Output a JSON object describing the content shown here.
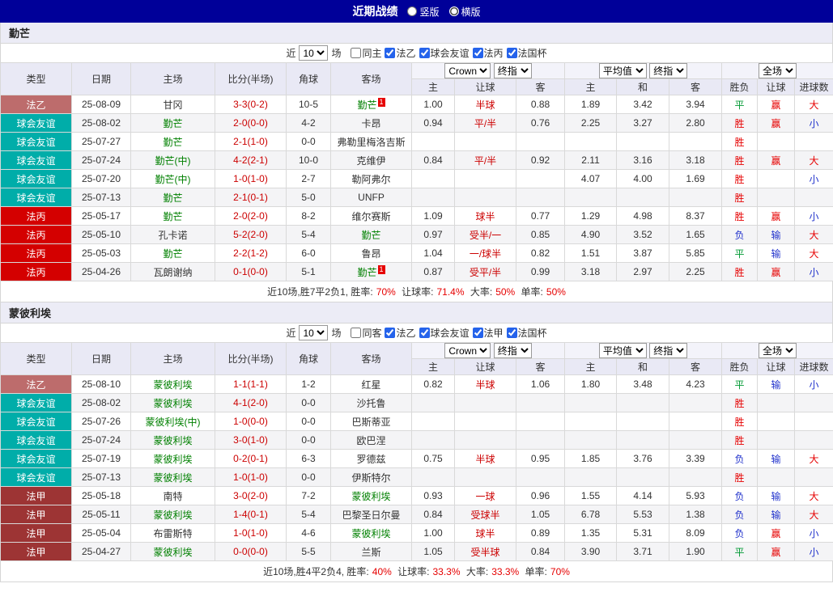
{
  "header": {
    "title": "近期战绩",
    "layout_options": [
      "竖版",
      "横版"
    ],
    "layout_checked": [
      false,
      true
    ],
    "selected_layout": "横版"
  },
  "filters": {
    "near_label": "近",
    "count": "10",
    "matches_label": "场"
  },
  "selects": {
    "company": "Crown",
    "final_odds": "终指",
    "average": "平均值",
    "full_match": "全场"
  },
  "columns": {
    "type": "类型",
    "date": "日期",
    "home": "主场",
    "score": "比分(半场)",
    "corner": "角球",
    "away": "客场",
    "odds_home": "主",
    "odds_handicap": "让球",
    "odds_away": "客",
    "avg_home": "主",
    "avg_draw": "和",
    "avg_away": "客",
    "result": "胜负",
    "handicap_result": "让球",
    "goals_result": "进球数"
  },
  "colors": {
    "title_bar": "#000099",
    "header_bg": "#e9e9f5",
    "score": "#cc0000",
    "handicap": "#cc0000",
    "self_team": "#008000",
    "opponent_team": "#333333",
    "badge": "#e60000",
    "highlight": "#e60000",
    "result_win": "#e60000",
    "result_draw": "#009933",
    "result_lose": "#2233cc"
  },
  "league_colors": {
    "法乙": "#bd6c6c",
    "球会友谊": "#00ada9",
    "法丙": "#d40000",
    "法甲": "#9d3434"
  },
  "sections": [
    {
      "team": "勤芒",
      "filter": {
        "same_label": "同主",
        "same_checked": false,
        "leagues": [
          "法乙",
          "球会友谊",
          "法丙",
          "法国杯"
        ],
        "leagues_checked": [
          true,
          true,
          true,
          true
        ]
      },
      "rows": [
        {
          "type": "法乙",
          "date": "25-08-09",
          "home": "甘冈",
          "home_self": false,
          "score": "3-3(0-2)",
          "corner": "10-5",
          "away": "勤芒",
          "away_self": true,
          "away_badge": "1",
          "odds": [
            "1.00",
            "半球",
            "0.88"
          ],
          "avg": [
            "1.89",
            "3.42",
            "3.94"
          ],
          "results": [
            "平",
            "赢",
            "大"
          ]
        },
        {
          "type": "球会友谊",
          "date": "25-08-02",
          "home": "勤芒",
          "home_self": true,
          "score": "2-0(0-0)",
          "corner": "4-2",
          "away": "卡昂",
          "away_self": false,
          "odds": [
            "0.94",
            "平/半",
            "0.76"
          ],
          "avg": [
            "2.25",
            "3.27",
            "2.80"
          ],
          "results": [
            "胜",
            "赢",
            "小"
          ]
        },
        {
          "type": "球会友谊",
          "date": "25-07-27",
          "home": "勤芒",
          "home_self": true,
          "score": "2-1(1-0)",
          "corner": "0-0",
          "away": "弗勒里梅洛吉斯",
          "away_self": false,
          "odds": [
            "",
            "",
            ""
          ],
          "avg": [
            "",
            "",
            ""
          ],
          "results": [
            "胜",
            "",
            ""
          ]
        },
        {
          "type": "球会友谊",
          "date": "25-07-24",
          "home": "勤芒(中)",
          "home_self": true,
          "score": "4-2(2-1)",
          "corner": "10-0",
          "away": "克维伊",
          "away_self": false,
          "odds": [
            "0.84",
            "平/半",
            "0.92"
          ],
          "avg": [
            "2.11",
            "3.16",
            "3.18"
          ],
          "results": [
            "胜",
            "赢",
            "大"
          ]
        },
        {
          "type": "球会友谊",
          "date": "25-07-20",
          "home": "勤芒(中)",
          "home_self": true,
          "score": "1-0(1-0)",
          "corner": "2-7",
          "away": "勒阿弗尔",
          "away_self": false,
          "odds": [
            "",
            "",
            ""
          ],
          "avg": [
            "4.07",
            "4.00",
            "1.69"
          ],
          "results": [
            "胜",
            "",
            "小"
          ]
        },
        {
          "type": "球会友谊",
          "date": "25-07-13",
          "home": "勤芒",
          "home_self": true,
          "score": "2-1(0-1)",
          "corner": "5-0",
          "away": "UNFP",
          "away_self": false,
          "odds": [
            "",
            "",
            ""
          ],
          "avg": [
            "",
            "",
            ""
          ],
          "results": [
            "胜",
            "",
            ""
          ]
        },
        {
          "type": "法丙",
          "date": "25-05-17",
          "home": "勤芒",
          "home_self": true,
          "score": "2-0(2-0)",
          "corner": "8-2",
          "away": "维尔赛斯",
          "away_self": false,
          "odds": [
            "1.09",
            "球半",
            "0.77"
          ],
          "avg": [
            "1.29",
            "4.98",
            "8.37"
          ],
          "results": [
            "胜",
            "赢",
            "小"
          ]
        },
        {
          "type": "法丙",
          "date": "25-05-10",
          "home": "孔卡诺",
          "home_self": false,
          "score": "5-2(2-0)",
          "corner": "5-4",
          "away": "勤芒",
          "away_self": true,
          "odds": [
            "0.97",
            "受半/一",
            "0.85"
          ],
          "avg": [
            "4.90",
            "3.52",
            "1.65"
          ],
          "results": [
            "负",
            "输",
            "大"
          ]
        },
        {
          "type": "法丙",
          "date": "25-05-03",
          "home": "勤芒",
          "home_self": true,
          "score": "2-2(1-2)",
          "corner": "6-0",
          "away": "鲁昂",
          "away_self": false,
          "odds": [
            "1.04",
            "一/球半",
            "0.82"
          ],
          "avg": [
            "1.51",
            "3.87",
            "5.85"
          ],
          "results": [
            "平",
            "输",
            "大"
          ]
        },
        {
          "type": "法丙",
          "date": "25-04-26",
          "home": "瓦朗谢纳",
          "home_self": false,
          "score": "0-1(0-0)",
          "corner": "5-1",
          "away": "勤芒",
          "away_self": true,
          "away_badge": "1",
          "odds": [
            "0.87",
            "受平/半",
            "0.99"
          ],
          "avg": [
            "3.18",
            "2.97",
            "2.25"
          ],
          "results": [
            "胜",
            "赢",
            "小"
          ]
        }
      ],
      "summary": [
        {
          "text": "近10场,胜7平2负1, 胜率:"
        },
        {
          "text": "70%",
          "highlight": true
        },
        {
          "text": " 让球率:"
        },
        {
          "text": "71.4%",
          "highlight": true
        },
        {
          "text": " 大率:"
        },
        {
          "text": "50%",
          "highlight": true
        },
        {
          "text": " 单率:"
        },
        {
          "text": "50%",
          "highlight": true
        }
      ]
    },
    {
      "team": "蒙彼利埃",
      "filter": {
        "same_label": "同客",
        "same_checked": false,
        "leagues": [
          "法乙",
          "球会友谊",
          "法甲",
          "法国杯"
        ],
        "leagues_checked": [
          true,
          true,
          true,
          true
        ]
      },
      "rows": [
        {
          "type": "法乙",
          "date": "25-08-10",
          "home": "蒙彼利埃",
          "home_self": true,
          "score": "1-1(1-1)",
          "corner": "1-2",
          "away": "红星",
          "away_self": false,
          "odds": [
            "0.82",
            "半球",
            "1.06"
          ],
          "avg": [
            "1.80",
            "3.48",
            "4.23"
          ],
          "results": [
            "平",
            "输",
            "小"
          ]
        },
        {
          "type": "球会友谊",
          "date": "25-08-02",
          "home": "蒙彼利埃",
          "home_self": true,
          "score": "4-1(2-0)",
          "corner": "0-0",
          "away": "沙托鲁",
          "away_self": false,
          "odds": [
            "",
            "",
            ""
          ],
          "avg": [
            "",
            "",
            ""
          ],
          "results": [
            "胜",
            "",
            ""
          ]
        },
        {
          "type": "球会友谊",
          "date": "25-07-26",
          "home": "蒙彼利埃(中)",
          "home_self": true,
          "score": "1-0(0-0)",
          "corner": "0-0",
          "away": "巴斯蒂亚",
          "away_self": false,
          "odds": [
            "",
            "",
            ""
          ],
          "avg": [
            "",
            "",
            ""
          ],
          "results": [
            "胜",
            "",
            ""
          ]
        },
        {
          "type": "球会友谊",
          "date": "25-07-24",
          "home": "蒙彼利埃",
          "home_self": true,
          "score": "3-0(1-0)",
          "corner": "0-0",
          "away": "欧巴涅",
          "away_self": false,
          "odds": [
            "",
            "",
            ""
          ],
          "avg": [
            "",
            "",
            ""
          ],
          "results": [
            "胜",
            "",
            ""
          ]
        },
        {
          "type": "球会友谊",
          "date": "25-07-19",
          "home": "蒙彼利埃",
          "home_self": true,
          "score": "0-2(0-1)",
          "corner": "6-3",
          "away": "罗德兹",
          "away_self": false,
          "odds": [
            "0.75",
            "半球",
            "0.95"
          ],
          "avg": [
            "1.85",
            "3.76",
            "3.39"
          ],
          "results": [
            "负",
            "输",
            "大"
          ]
        },
        {
          "type": "球会友谊",
          "date": "25-07-13",
          "home": "蒙彼利埃",
          "home_self": true,
          "score": "1-0(1-0)",
          "corner": "0-0",
          "away": "伊斯特尔",
          "away_self": false,
          "odds": [
            "",
            "",
            ""
          ],
          "avg": [
            "",
            "",
            ""
          ],
          "results": [
            "胜",
            "",
            ""
          ]
        },
        {
          "type": "法甲",
          "date": "25-05-18",
          "home": "南特",
          "home_self": false,
          "score": "3-0(2-0)",
          "corner": "7-2",
          "away": "蒙彼利埃",
          "away_self": true,
          "odds": [
            "0.93",
            "一球",
            "0.96"
          ],
          "avg": [
            "1.55",
            "4.14",
            "5.93"
          ],
          "results": [
            "负",
            "输",
            "大"
          ]
        },
        {
          "type": "法甲",
          "date": "25-05-11",
          "home": "蒙彼利埃",
          "home_self": true,
          "score": "1-4(0-1)",
          "corner": "5-4",
          "away": "巴黎圣日尔曼",
          "away_self": false,
          "odds": [
            "0.84",
            "受球半",
            "1.05"
          ],
          "avg": [
            "6.78",
            "5.53",
            "1.38"
          ],
          "results": [
            "负",
            "输",
            "大"
          ]
        },
        {
          "type": "法甲",
          "date": "25-05-04",
          "home": "布雷斯特",
          "home_self": false,
          "score": "1-0(1-0)",
          "corner": "4-6",
          "away": "蒙彼利埃",
          "away_self": true,
          "odds": [
            "1.00",
            "球半",
            "0.89"
          ],
          "avg": [
            "1.35",
            "5.31",
            "8.09"
          ],
          "results": [
            "负",
            "赢",
            "小"
          ]
        },
        {
          "type": "法甲",
          "date": "25-04-27",
          "home": "蒙彼利埃",
          "home_self": true,
          "score": "0-0(0-0)",
          "corner": "5-5",
          "away": "兰斯",
          "away_self": false,
          "odds": [
            "1.05",
            "受半球",
            "0.84"
          ],
          "avg": [
            "3.90",
            "3.71",
            "1.90"
          ],
          "results": [
            "平",
            "赢",
            "小"
          ]
        }
      ],
      "summary": [
        {
          "text": "近10场,胜4平2负4, 胜率:"
        },
        {
          "text": "40%",
          "highlight": true
        },
        {
          "text": " 让球率:"
        },
        {
          "text": "33.3%",
          "highlight": true
        },
        {
          "text": " 大率:"
        },
        {
          "text": "33.3%",
          "highlight": true
        },
        {
          "text": " 单率:"
        },
        {
          "text": "70%",
          "highlight": true
        }
      ]
    }
  ]
}
